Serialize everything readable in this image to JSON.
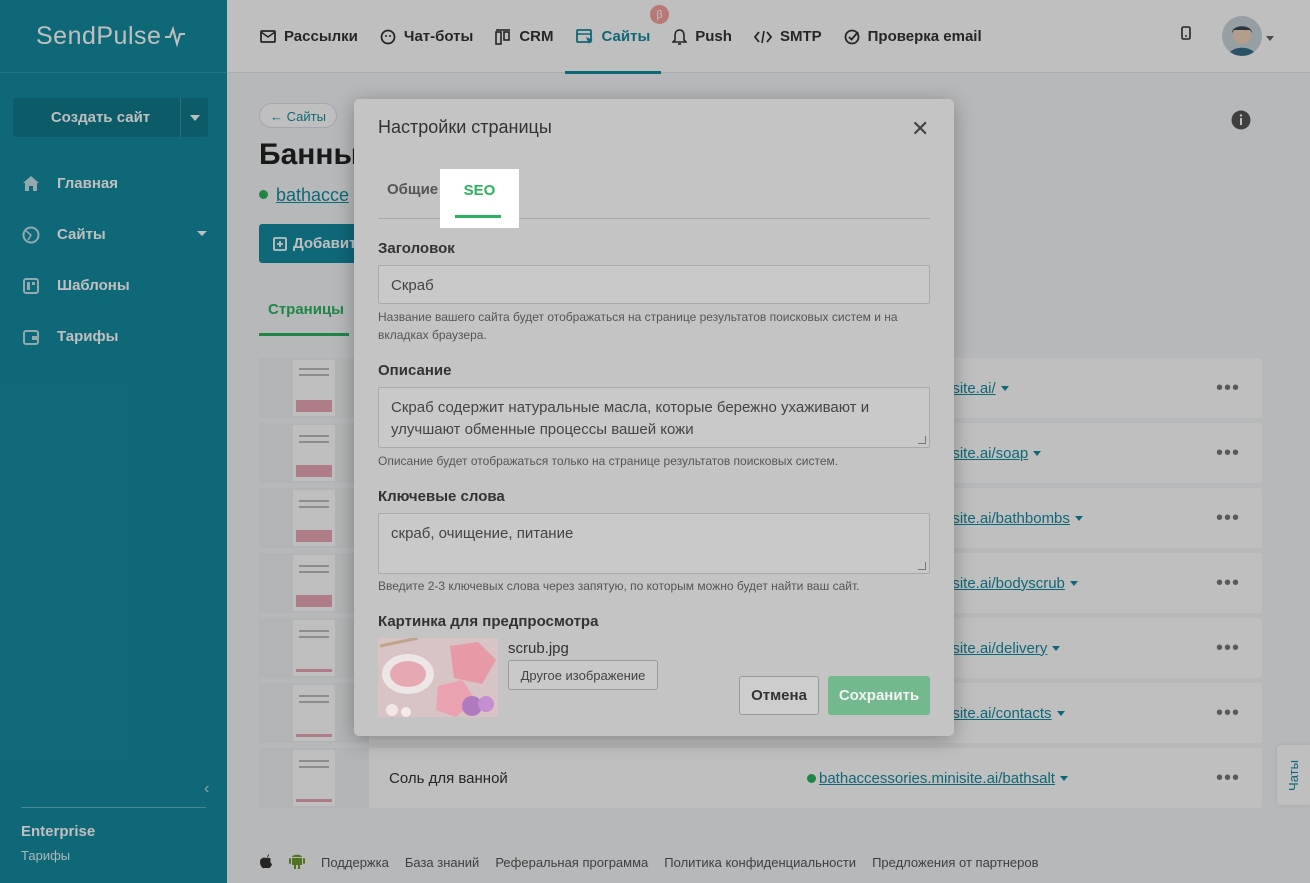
{
  "brand": {
    "logo_text": "SendPulse"
  },
  "sidebar": {
    "create_button": "Создать сайт",
    "items": [
      {
        "label": "Главная",
        "icon": "home-icon"
      },
      {
        "label": "Сайты",
        "icon": "globe-icon"
      },
      {
        "label": "Шаблоны",
        "icon": "template-icon"
      },
      {
        "label": "Тарифы",
        "icon": "wallet-icon"
      }
    ],
    "plan_name": "Enterprise",
    "plan_link": "Тарифы"
  },
  "topnav": {
    "items": [
      {
        "label": "Рассылки",
        "icon": "mail-icon"
      },
      {
        "label": "Чат-боты",
        "icon": "chatbot-icon"
      },
      {
        "label": "CRM",
        "icon": "crm-icon"
      },
      {
        "label": "Сайты",
        "icon": "sites-icon",
        "active": true
      },
      {
        "label": "Push",
        "icon": "bell-icon"
      },
      {
        "label": "SMTP",
        "icon": "code-icon"
      },
      {
        "label": "Проверка email",
        "icon": "check-circle-icon"
      }
    ],
    "beta_badge": "β"
  },
  "main": {
    "back_link": "← Сайты",
    "page_title": "Банны",
    "site_url": "bathacce",
    "add_button": "Добавит",
    "tab_pages": "Страницы",
    "rows": [
      {
        "name": "",
        "url": "isite.ai/"
      },
      {
        "name": "",
        "url": "isite.ai/soap"
      },
      {
        "name": "",
        "url": "isite.ai/bathbombs"
      },
      {
        "name": "",
        "url": "isite.ai/bodyscrub"
      },
      {
        "name": "",
        "url": "isite.ai/delivery"
      },
      {
        "name": "",
        "url": "isite.ai/contacts"
      },
      {
        "name": "Соль для ванной",
        "url": "bathaccessories.minisite.ai/bathsalt"
      }
    ]
  },
  "footer": {
    "links": [
      "Поддержка",
      "База знаний",
      "Реферальная программа",
      "Политика конфиденциальности",
      "Предложения от партнеров"
    ]
  },
  "chats_tab": "Чаты",
  "modal": {
    "title": "Настройки страницы",
    "tabs": {
      "general": "Общие",
      "seo": "SEO"
    },
    "title_label": "Заголовок",
    "title_value": "Скраб",
    "title_hint": "Название вашего сайта будет отображаться на странице результатов поисковых систем и на вкладках браузера.",
    "description_label": "Описание",
    "description_value": "Скраб содержит натуральные масла, которые бережно ухаживают и улучшают обменные процессы вашей кожи",
    "description_hint": "Описание будет отображаться только на странице результатов поисковых систем.",
    "keywords_label": "Ключевые слова",
    "keywords_value": "скраб, очищение, питание",
    "keywords_hint": "Введите 2-3 ключевых слова через запятую, по которым можно будет найти ваш сайт.",
    "preview_label": "Картинка для предпросмотра",
    "preview_filename": "scrub.jpg",
    "other_image_button": "Другое изображение",
    "cancel_button": "Отмена",
    "save_button": "Сохранить"
  },
  "colors": {
    "brand": "#158ba0",
    "accent_green": "#2ab35e"
  }
}
